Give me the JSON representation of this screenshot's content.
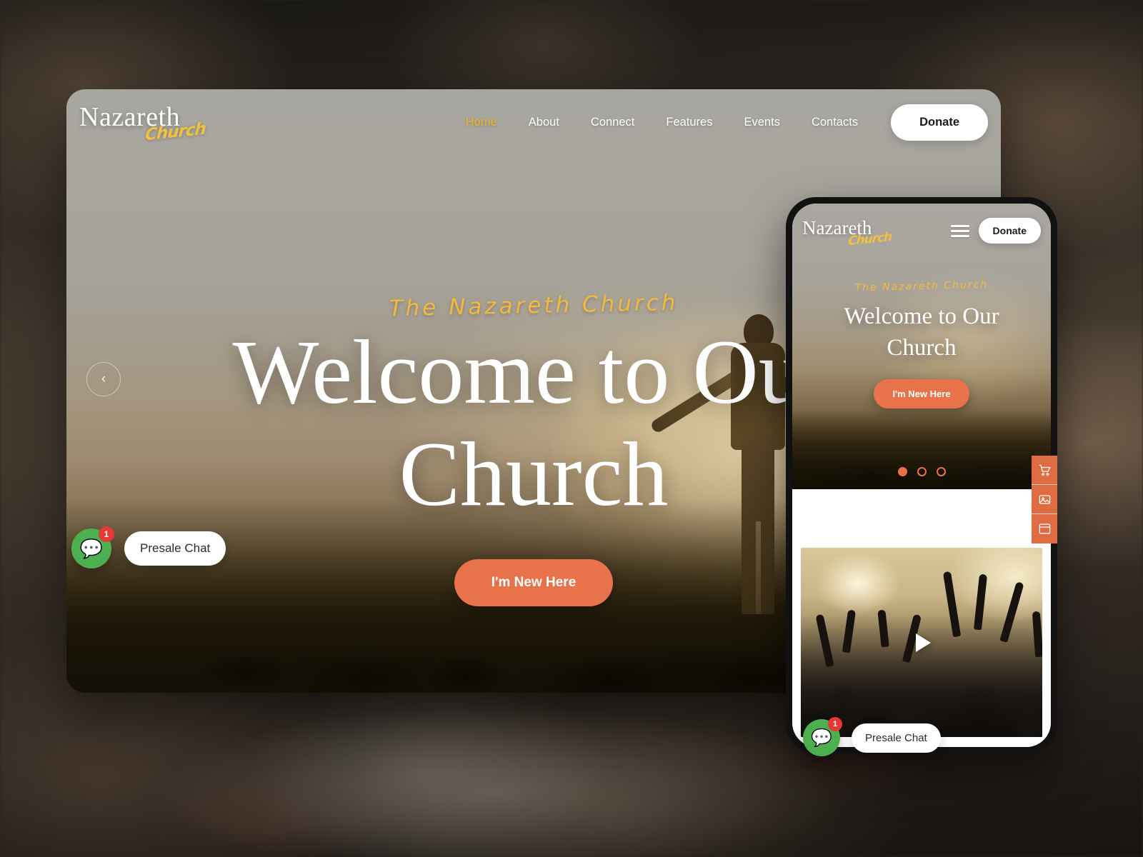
{
  "backdrop": {
    "description": "blurred dark photo of hands over an open bible"
  },
  "desktop": {
    "brand": {
      "main": "Nazareth",
      "script": "Church"
    },
    "nav": {
      "items": [
        {
          "label": "Home",
          "active": true
        },
        {
          "label": "About",
          "active": false
        },
        {
          "label": "Connect",
          "active": false
        },
        {
          "label": "Features",
          "active": false
        },
        {
          "label": "Events",
          "active": false
        },
        {
          "label": "Contacts",
          "active": false
        }
      ],
      "donate_label": "Donate"
    },
    "hero": {
      "script_label": "The Nazareth Church",
      "title_line1": "Welcome to Our",
      "title_line2": "Church",
      "cta_label": "I'm New Here",
      "prev_arrow": "‹"
    },
    "chat": {
      "label": "Presale Chat",
      "badge": "1",
      "icon": "chat-icon"
    }
  },
  "mobile": {
    "brand": {
      "main": "Nazareth",
      "script": "Church"
    },
    "nav": {
      "menu_icon": "hamburger-icon",
      "donate_label": "Donate"
    },
    "hero": {
      "script_label": "The Nazareth Church",
      "title": "Welcome to Our Church",
      "cta_label": "I'm New Here"
    },
    "carousel": {
      "dots": [
        "active",
        "inactive",
        "inactive"
      ]
    },
    "video": {
      "play_icon": "play-icon",
      "alt": "concert crowd with raised hands"
    },
    "chat": {
      "label": "Presale Chat",
      "badge": "1",
      "icon": "chat-icon"
    }
  },
  "side_tabs": [
    {
      "icon": "cart-icon"
    },
    {
      "icon": "image-icon"
    },
    {
      "icon": "window-icon"
    }
  ],
  "colors": {
    "accent_orange": "#e8734a",
    "accent_yellow": "#f0b429",
    "chat_green": "#4caf50",
    "badge_red": "#e53935",
    "white": "#ffffff"
  }
}
